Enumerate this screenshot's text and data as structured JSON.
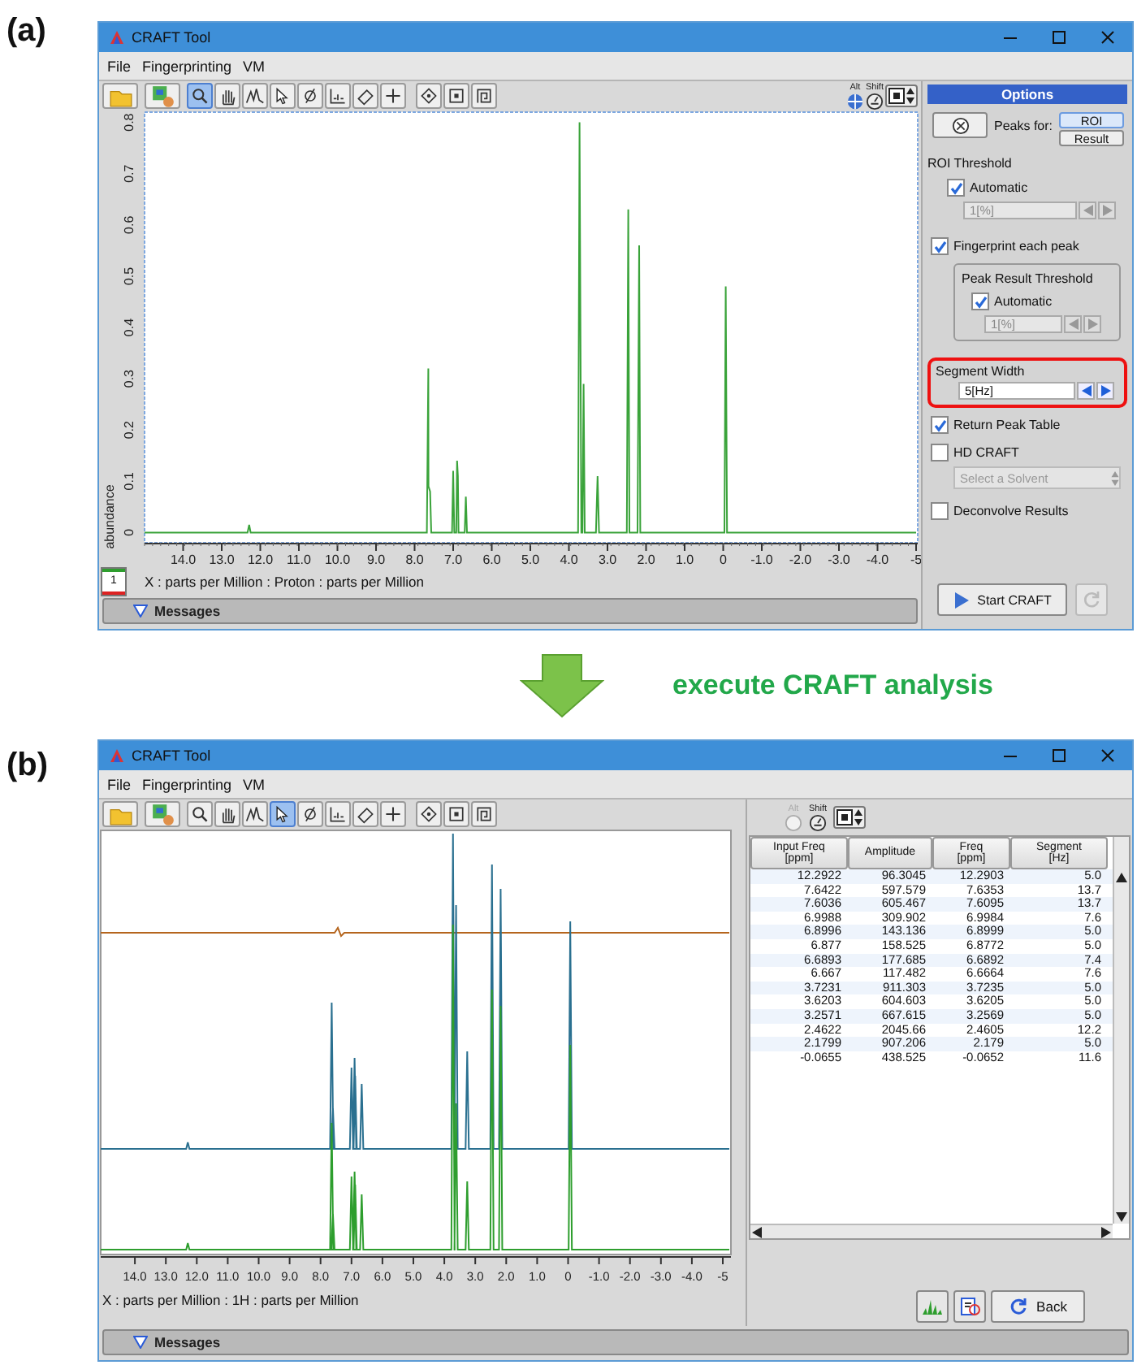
{
  "panel_a": {
    "label": "(a)",
    "window": {
      "title": "CRAFT Tool",
      "menu": [
        "File",
        "Fingerprinting",
        "VM"
      ],
      "toolbar": [
        {
          "kind": "folder",
          "selected": false
        },
        {
          "kind": "import",
          "selected": false
        },
        {
          "kind": "zoom",
          "selected": true
        },
        {
          "kind": "hand",
          "selected": false
        },
        {
          "kind": "peaks",
          "selected": false
        },
        {
          "kind": "pointer",
          "selected": false
        },
        {
          "kind": "phase",
          "selected": false
        },
        {
          "kind": "baseline",
          "selected": false
        },
        {
          "kind": "eraser",
          "selected": false
        },
        {
          "kind": "plus",
          "selected": false
        },
        {
          "kind": "diamond",
          "selected": false
        },
        {
          "kind": "square",
          "selected": false
        },
        {
          "kind": "spiral",
          "selected": false
        }
      ],
      "modifiers": [
        {
          "kind": "alt",
          "label": "Alt",
          "enabled": true
        },
        {
          "kind": "shift",
          "label": "Shift",
          "enabled": true
        }
      ],
      "chart_data": {
        "type": "line",
        "xlabel": "X : parts per Million : Proton : parts per Million",
        "ylabel": "abundance",
        "xlim": [
          15,
          -5
        ],
        "ylim": [
          -0.02,
          0.82
        ],
        "x": [
          15,
          12.33,
          12.29,
          12.25,
          7.68,
          7.645,
          7.64,
          7.6,
          7.57,
          7.03,
          6.999,
          6.97,
          6.92,
          6.9,
          6.88,
          6.86,
          6.7,
          6.67,
          6.64,
          3.76,
          3.723,
          3.68,
          3.65,
          3.62,
          3.59,
          3.3,
          3.257,
          3.22,
          2.5,
          2.462,
          2.43,
          2.22,
          2.18,
          2.15,
          -0.03,
          -0.066,
          -0.1,
          -5
        ],
        "series": [
          {
            "name": "1",
            "color": "#3aa33a",
            "values": [
              0,
              0,
              0.015,
              0,
              0,
              0.32,
              0.09,
              0.08,
              0,
              0,
              0.12,
              0,
              0,
              0.14,
              0.11,
              0,
              0,
              0.07,
              0,
              0,
              0.8,
              0,
              0,
              0.29,
              0,
              0,
              0.11,
              0,
              0,
              0.63,
              0,
              0,
              0.56,
              0,
              0,
              0.48,
              0,
              0
            ]
          }
        ],
        "xticks": [
          {
            "value": 14,
            "label": "14.0"
          },
          {
            "value": 13,
            "label": "13.0"
          },
          {
            "value": 12,
            "label": "12.0"
          },
          {
            "value": 11,
            "label": "11.0"
          },
          {
            "value": 10,
            "label": "10.0"
          },
          {
            "value": 9,
            "label": "9.0"
          },
          {
            "value": 8,
            "label": "8.0"
          },
          {
            "value": 7,
            "label": "7.0"
          },
          {
            "value": 6,
            "label": "6.0"
          },
          {
            "value": 5,
            "label": "5.0"
          },
          {
            "value": 4,
            "label": "4.0"
          },
          {
            "value": 3,
            "label": "3.0"
          },
          {
            "value": 2,
            "label": "2.0"
          },
          {
            "value": 1,
            "label": "1.0"
          },
          {
            "value": 0,
            "label": "0"
          },
          {
            "value": -1,
            "label": "-1.0"
          },
          {
            "value": -2,
            "label": "-2.0"
          },
          {
            "value": -3,
            "label": "-3.0"
          },
          {
            "value": -4,
            "label": "-4.0"
          },
          {
            "value": -5,
            "label": "-5"
          }
        ],
        "yticks": [
          0,
          0.1,
          0.2,
          0.3,
          0.4,
          0.5,
          0.6,
          0.7,
          0.8
        ]
      },
      "messages": "Messages",
      "options": {
        "title": "Options",
        "peaks_for": {
          "label": "Peaks for:",
          "choices": [
            {
              "label": "ROI",
              "selected": true
            },
            {
              "label": "Result",
              "selected": false
            }
          ]
        },
        "roi_threshold": {
          "label": "ROI Threshold",
          "automatic": {
            "label": "Automatic",
            "checked": true
          },
          "value": "1[%]",
          "disabled": true
        },
        "fingerprint": {
          "label": "Fingerprint each peak",
          "checked": true
        },
        "peak_result_threshold": {
          "label": "Peak Result Threshold",
          "automatic": {
            "label": "Automatic",
            "checked": true
          },
          "value": "1[%]",
          "disabled": true
        },
        "segment_width": {
          "label": "Segment Width",
          "value": "5[Hz]",
          "highlighted": true
        },
        "return_peak_table": {
          "label": "Return Peak Table",
          "checked": true
        },
        "hd_craft": {
          "label": "HD CRAFT",
          "checked": false
        },
        "solvent": {
          "placeholder": "Select a Solvent",
          "disabled": true
        },
        "deconvolve": {
          "label": "Deconvolve Results",
          "checked": false
        },
        "start_button": "Start CRAFT"
      }
    }
  },
  "transition": {
    "text": "execute CRAFT analysis"
  },
  "panel_b": {
    "label": "(b)",
    "window": {
      "title": "CRAFT Tool",
      "menu": [
        "File",
        "Fingerprinting",
        "VM"
      ],
      "toolbar": [
        {
          "kind": "folder",
          "selected": false
        },
        {
          "kind": "import",
          "selected": false
        },
        {
          "kind": "zoom",
          "selected": false
        },
        {
          "kind": "hand",
          "selected": false
        },
        {
          "kind": "peaks",
          "selected": false
        },
        {
          "kind": "pointer",
          "selected": true
        },
        {
          "kind": "phase",
          "selected": false
        },
        {
          "kind": "baseline",
          "selected": false
        },
        {
          "kind": "eraser",
          "selected": false
        },
        {
          "kind": "plus",
          "selected": false
        },
        {
          "kind": "diamond",
          "selected": false
        },
        {
          "kind": "square",
          "selected": false
        },
        {
          "kind": "spiral",
          "selected": false
        }
      ],
      "modifiers": [
        {
          "kind": "alt",
          "label": "Alt",
          "enabled": false
        },
        {
          "kind": "shift",
          "label": "Shift",
          "enabled": true
        }
      ],
      "axis_labels": [
        "14.0",
        "13.0",
        "12.0",
        "11.0",
        "10.0",
        "9.0",
        "8.0",
        "7.0",
        "6.0",
        "5.0",
        "4.0",
        "3.0",
        "2.0",
        "1.0",
        "0",
        "-1.0",
        "-2.0",
        "-3.0",
        "-4.0",
        "-5"
      ],
      "xlabel": "X : parts per Million : 1H : parts per Million",
      "table": {
        "columns": [
          "Input Freq\n[ppm]",
          "Amplitude",
          "Freq\n[ppm]",
          "Segment\n[Hz]"
        ],
        "rows": [
          [
            "12.2922",
            "96.3045",
            "12.2903",
            "5.0"
          ],
          [
            "7.6422",
            "597.579",
            "7.6353",
            "13.7"
          ],
          [
            "7.6036",
            "605.467",
            "7.6095",
            "13.7"
          ],
          [
            "6.9988",
            "309.902",
            "6.9984",
            "7.6"
          ],
          [
            "6.8996",
            "143.136",
            "6.8999",
            "5.0"
          ],
          [
            "6.877",
            "158.525",
            "6.8772",
            "5.0"
          ],
          [
            "6.6893",
            "177.685",
            "6.6892",
            "7.4"
          ],
          [
            "6.667",
            "117.482",
            "6.6664",
            "7.6"
          ],
          [
            "3.7231",
            "911.303",
            "3.7235",
            "5.0"
          ],
          [
            "3.6203",
            "604.603",
            "3.6205",
            "5.0"
          ],
          [
            "3.2571",
            "667.615",
            "3.2569",
            "5.0"
          ],
          [
            "2.4622",
            "2045.66",
            "2.4605",
            "12.2"
          ],
          [
            "2.1799",
            "907.206",
            "2.179",
            "5.0"
          ],
          [
            "-0.0655",
            "438.525",
            "-0.0652",
            "11.6"
          ]
        ]
      },
      "buttons": [
        {
          "kind": "spectrum"
        },
        {
          "kind": "export"
        },
        {
          "kind": "back",
          "label": "Back"
        }
      ],
      "messages": "Messages"
    }
  }
}
